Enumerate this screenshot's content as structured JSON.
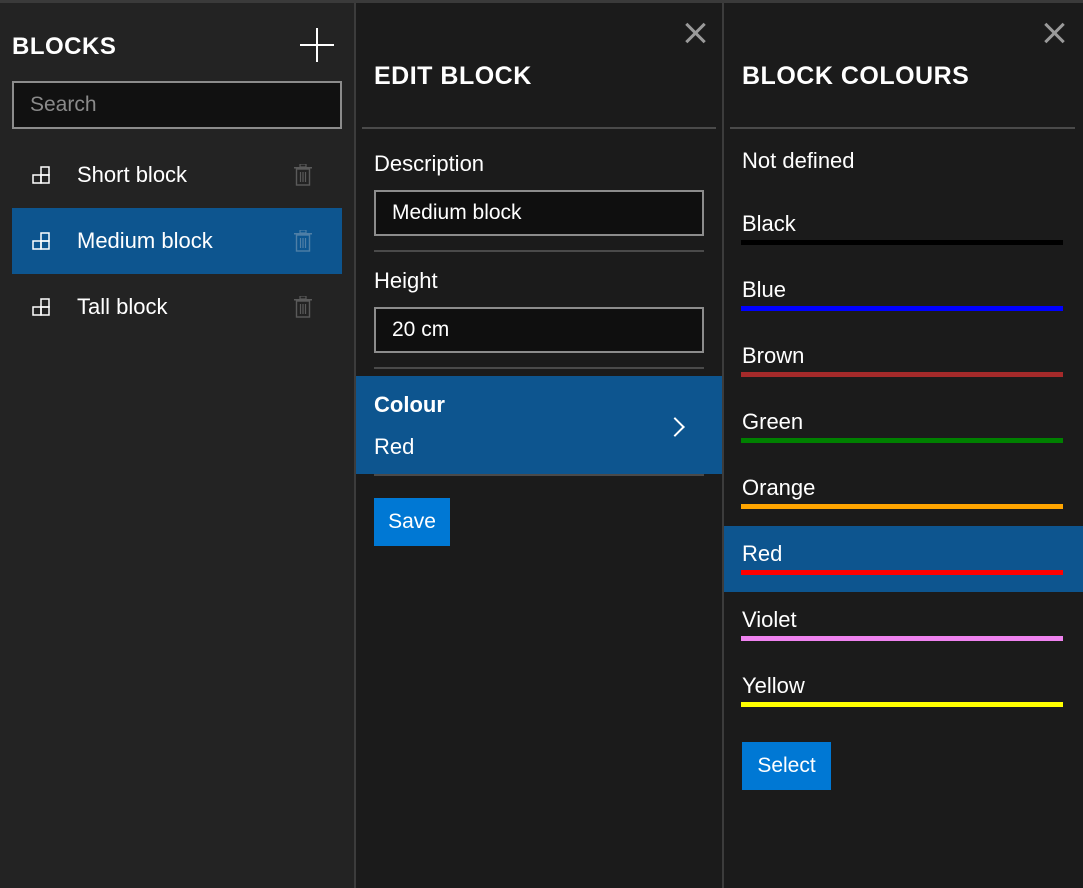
{
  "blocks_panel": {
    "title": "BLOCKS",
    "search_placeholder": "Search",
    "items": [
      {
        "label": "Short block",
        "selected": false
      },
      {
        "label": "Medium block",
        "selected": true
      },
      {
        "label": "Tall block",
        "selected": false
      }
    ]
  },
  "edit_panel": {
    "title": "EDIT BLOCK",
    "description_label": "Description",
    "description_value": "Medium block",
    "height_label": "Height",
    "height_value": "20 cm",
    "colour_label": "Colour",
    "colour_value": "Red",
    "save_label": "Save"
  },
  "colours_panel": {
    "title": "BLOCK COLOURS",
    "not_defined_label": "Not defined",
    "colours": [
      {
        "name": "Black",
        "hex": "#000000",
        "selected": false
      },
      {
        "name": "Blue",
        "hex": "#0000ff",
        "selected": false
      },
      {
        "name": "Brown",
        "hex": "#a52a2a",
        "selected": false
      },
      {
        "name": "Green",
        "hex": "#008000",
        "selected": false
      },
      {
        "name": "Orange",
        "hex": "#ffa500",
        "selected": false
      },
      {
        "name": "Red",
        "hex": "#ff0000",
        "selected": true
      },
      {
        "name": "Violet",
        "hex": "#ee82ee",
        "selected": false
      },
      {
        "name": "Yellow",
        "hex": "#ffff00",
        "selected": false
      }
    ],
    "select_label": "Select"
  },
  "theme": {
    "accent": "#0078d4",
    "selection": "#0d558f"
  }
}
